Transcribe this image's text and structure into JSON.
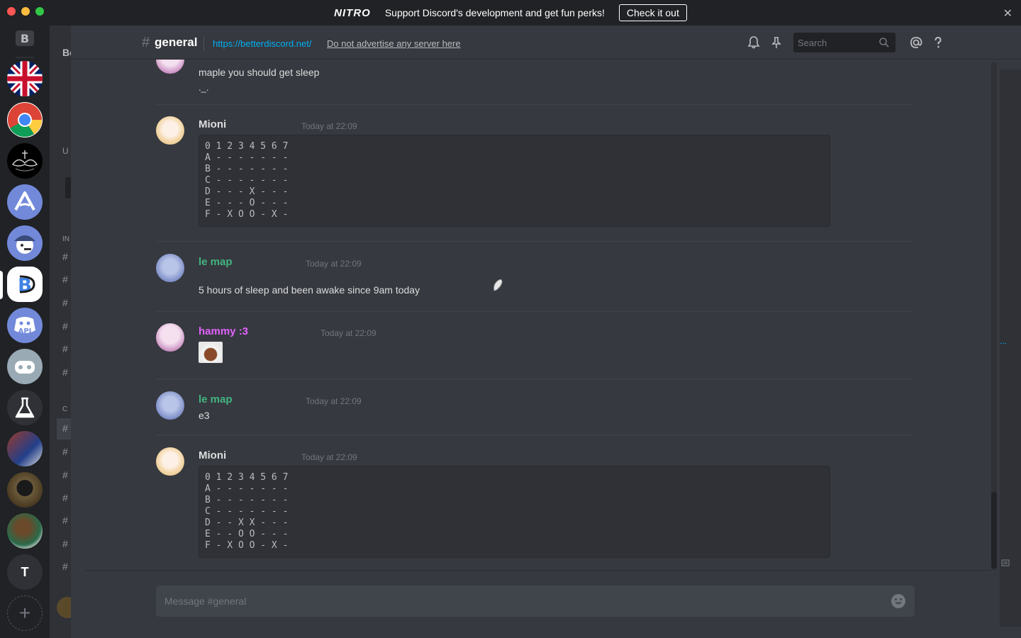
{
  "banner": {
    "logo": "NITRO",
    "text": "Support Discord's development and get fun perks!",
    "button": "Check it out",
    "close": "✕"
  },
  "servers": [
    {
      "name": "BetterDiscord (top)",
      "glyph": "B"
    },
    {
      "name": "UK flag server",
      "glyph": ""
    },
    {
      "name": "Chrome server",
      "glyph": ""
    },
    {
      "name": "Ornament server",
      "glyph": ""
    },
    {
      "name": "Mountain server",
      "glyph": ""
    },
    {
      "name": "Character server",
      "glyph": ""
    },
    {
      "name": "BetterDiscord",
      "glyph": "B"
    },
    {
      "name": "Discord API",
      "glyph": "API"
    },
    {
      "name": "Gamepad server",
      "glyph": ""
    },
    {
      "name": "Flask server",
      "glyph": ""
    },
    {
      "name": "Photo server 1",
      "glyph": ""
    },
    {
      "name": "Photo server 2",
      "glyph": ""
    },
    {
      "name": "Photo server 3",
      "glyph": ""
    },
    {
      "name": "T server",
      "glyph": "T"
    },
    {
      "name": "Add server",
      "glyph": "+"
    }
  ],
  "sidebar_fragments": {
    "server_name": "Be",
    "section_u": "U",
    "category_1": "IN",
    "category_2": "C",
    "hash": "#"
  },
  "header": {
    "hash": "#",
    "channel": "general",
    "topic_link": "https://betterdiscord.net/",
    "topic_text": "Do not advertise any server here",
    "search_placeholder": "Search"
  },
  "messages": [
    {
      "type": "cont",
      "text1": "maple you should get sleep",
      "text2": "._."
    },
    {
      "author": "Mioni",
      "color": "#dcddde",
      "time": "Today at 22:09",
      "code": "0 1 2 3 4 5 6 7\nA - - - - - - -\nB - - - - - - -\nC - - - - - - -\nD - - - X - - -\nE - - - O - - -\nF - X O O - X -"
    },
    {
      "author": "le map",
      "color": "#43b581",
      "time": "Today at 22:09",
      "text": "5 hours of sleep and been awake since 9am today"
    },
    {
      "author": "hammy :3",
      "color": "#e362ff",
      "time": "Today at 22:09"
    },
    {
      "author": "le map",
      "color": "#43b581",
      "time": "Today at 22:09",
      "text": "e3"
    },
    {
      "author": "Mioni",
      "color": "#dcddde",
      "time": "Today at 22:09",
      "code": "0 1 2 3 4 5 6 7\nA - - - - - - -\nB - - - - - - -\nC - - - - - - -\nD - - X X - - -\nE - - O O - - -\nF - X O O - X -"
    }
  ],
  "composer": {
    "placeholder": "Message #general"
  },
  "right_panel": {
    "dots": "..."
  }
}
